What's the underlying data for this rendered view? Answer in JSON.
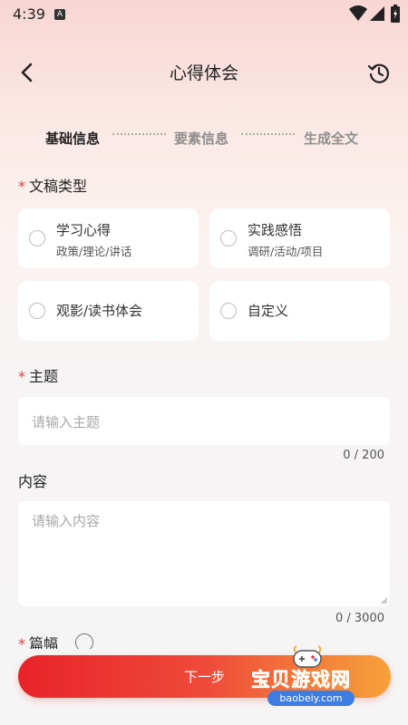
{
  "status": {
    "time": "4:39",
    "notification": "A"
  },
  "header": {
    "title": "心得体会",
    "back_icon": "back-arrow-icon",
    "history_icon": "history-icon"
  },
  "steps": [
    {
      "label": "基础信息",
      "state": "active"
    },
    {
      "label": "要素信息",
      "state": "inactive"
    },
    {
      "label": "生成全文",
      "state": "inactive"
    }
  ],
  "doc_type": {
    "label": "文稿类型",
    "required": "*",
    "options": [
      {
        "title": "学习心得",
        "subtitle": "政策/理论/讲话",
        "selected": false
      },
      {
        "title": "实践感悟",
        "subtitle": "调研/活动/项目",
        "selected": false
      },
      {
        "title": "观影/读书体会",
        "subtitle": "",
        "selected": false
      },
      {
        "title": "自定义",
        "subtitle": "",
        "selected": false
      }
    ]
  },
  "topic": {
    "label": "主题",
    "required": "*",
    "placeholder": "请输入主题",
    "counter": "0 / 200"
  },
  "content": {
    "label": "内容",
    "placeholder": "请输入内容",
    "counter": "0 / 3000"
  },
  "length": {
    "label": "篇幅",
    "required": "*",
    "info_icon": "info-icon"
  },
  "footer": {
    "next_label": "下一步"
  },
  "watermark": {
    "brand": "宝贝游戏网",
    "url": "baobeiy.com"
  },
  "colors": {
    "accent_red": "#e8232a",
    "accent_orange": "#f6a23a",
    "required_star": "#e53935"
  }
}
